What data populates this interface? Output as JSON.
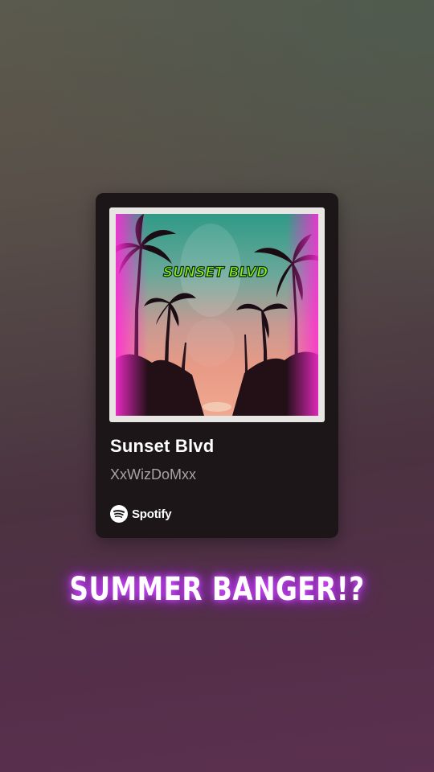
{
  "story": {
    "caption": "SUMMER BANGER!?"
  },
  "track_card": {
    "cover_text": "SUNSET BLVD",
    "title": "Sunset Blvd",
    "artist": "XxWizDoMxx",
    "brand": "Spotify",
    "brand_icon": "spotify-logo-icon"
  },
  "colors": {
    "card_background": "#1c1619",
    "cover_text": "#86f21c",
    "caption_glow": "#c43cff"
  }
}
